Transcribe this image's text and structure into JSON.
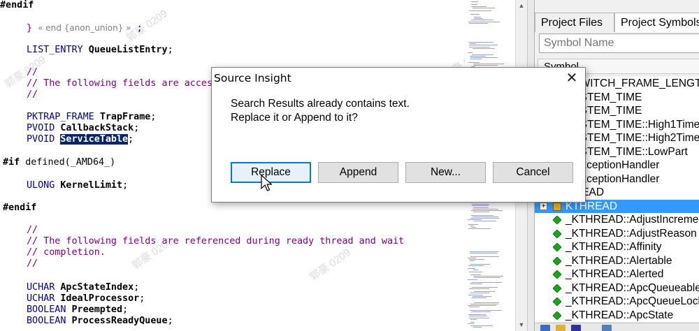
{
  "editor": {
    "lines": [
      {
        "type": "pp",
        "text": "#endif"
      },
      {
        "type": "mixed",
        "parts": [
          [
            "cm",
            "} "
          ],
          [
            "cmg",
            "« end {anon_union} »"
          ],
          [
            "plain",
            " ;"
          ]
        ]
      },
      {
        "type": "mixed",
        "parts": [
          [
            "kw",
            "LIST_ENTRY "
          ],
          [
            "id",
            "QueueListEntry"
          ],
          [
            "plain",
            ";"
          ]
        ]
      },
      {
        "type": "cm",
        "text": "//"
      },
      {
        "type": "cm",
        "text": "// The following fields are acces"
      },
      {
        "type": "cm",
        "text": "//"
      },
      {
        "type": "mixed",
        "parts": [
          [
            "kw",
            "PKTRAP_FRAME "
          ],
          [
            "id",
            "TrapFrame"
          ],
          [
            "plain",
            ";"
          ]
        ]
      },
      {
        "type": "mixed",
        "parts": [
          [
            "kw",
            "PVOID "
          ],
          [
            "id",
            "CallbackStack"
          ],
          [
            "plain",
            ";"
          ]
        ]
      },
      {
        "type": "mixed",
        "parts": [
          [
            "kw",
            "PVOID "
          ],
          [
            "sel",
            "ServiceTable"
          ],
          [
            "plain",
            ";"
          ]
        ]
      },
      {
        "type": "mixed",
        "parts": [
          [
            "pp",
            "#if "
          ],
          [
            "plain",
            "defined(_AMD64_)"
          ]
        ]
      },
      {
        "type": "mixed",
        "parts": [
          [
            "kw",
            "ULONG "
          ],
          [
            "id",
            "KernelLimit"
          ],
          [
            "plain",
            ";"
          ]
        ]
      },
      {
        "type": "pp",
        "text": "#endif"
      },
      {
        "type": "cm",
        "text": "//"
      },
      {
        "type": "cm",
        "text": "// The following fields are referenced during ready thread and wait"
      },
      {
        "type": "cm",
        "text": "// completion."
      },
      {
        "type": "cm",
        "text": "//"
      },
      {
        "type": "mixed",
        "parts": [
          [
            "kw",
            "UCHAR "
          ],
          [
            "id",
            "ApcStateIndex"
          ],
          [
            "plain",
            ";"
          ]
        ]
      },
      {
        "type": "mixed",
        "parts": [
          [
            "kw",
            "UCHAR "
          ],
          [
            "id",
            "IdealProcessor"
          ],
          [
            "plain",
            ";"
          ]
        ]
      },
      {
        "type": "mixed",
        "parts": [
          [
            "kw",
            "BOOLEAN "
          ],
          [
            "id",
            "Preempted"
          ],
          [
            "plain",
            ";"
          ]
        ]
      },
      {
        "type": "mixed",
        "parts": [
          [
            "kw",
            "BOOLEAN "
          ],
          [
            "id",
            "ProcessReadyQueue"
          ],
          [
            "plain",
            ";"
          ]
        ]
      }
    ]
  },
  "watermark": "郭豪 0209",
  "panel": {
    "tabs": {
      "files": "Project Files",
      "symbols": "Project Symbols"
    },
    "search_placeholder": "Symbol Name",
    "header": "Symbol",
    "symbols": [
      {
        "text": "_WITCH_FRAME_LENGTH",
        "icon": "none"
      },
      {
        "text": "_STEM_TIME",
        "icon": "none"
      },
      {
        "text": "_STEM_TIME",
        "icon": "none"
      },
      {
        "text": "_STEM_TIME::High1Time",
        "icon": "none"
      },
      {
        "text": "_STEM_TIME::High2Time",
        "icon": "none"
      },
      {
        "text": "_STEM_TIME::LowPart",
        "icon": "none"
      },
      {
        "text": "ExceptionHandler",
        "icon": "none"
      },
      {
        "text": "ExceptionHandler",
        "icon": "none"
      },
      {
        "text": "READ",
        "icon": "none"
      },
      {
        "text": "KTHREAD",
        "icon": "struct",
        "selected": true
      },
      {
        "text": "_KTHREAD::AdjustIncrement",
        "icon": "member"
      },
      {
        "text": "_KTHREAD::AdjustReason",
        "icon": "member"
      },
      {
        "text": "_KTHREAD::Affinity",
        "icon": "member"
      },
      {
        "text": "_KTHREAD::Alertable",
        "icon": "member"
      },
      {
        "text": "_KTHREAD::Alerted",
        "icon": "member"
      },
      {
        "text": "_KTHREAD::ApcQueueable",
        "icon": "member"
      },
      {
        "text": "_KTHREAD::ApcQueueLock",
        "icon": "member"
      },
      {
        "text": "_KTHREAD::ApcState",
        "icon": "member"
      }
    ]
  },
  "dialog": {
    "title": "Source Insight",
    "close": "✕",
    "message_line1": "Search Results already contains text.",
    "message_line2": "Replace it or Append to it?",
    "buttons": {
      "replace": "Replace",
      "append": "Append",
      "new": "New...",
      "cancel": "Cancel"
    }
  },
  "colors": {
    "keyword": "#0000a0",
    "comment": "#800080",
    "selection": "#0a246a",
    "selected_row": "#3399ff",
    "member_icon": "#1aa51a"
  }
}
